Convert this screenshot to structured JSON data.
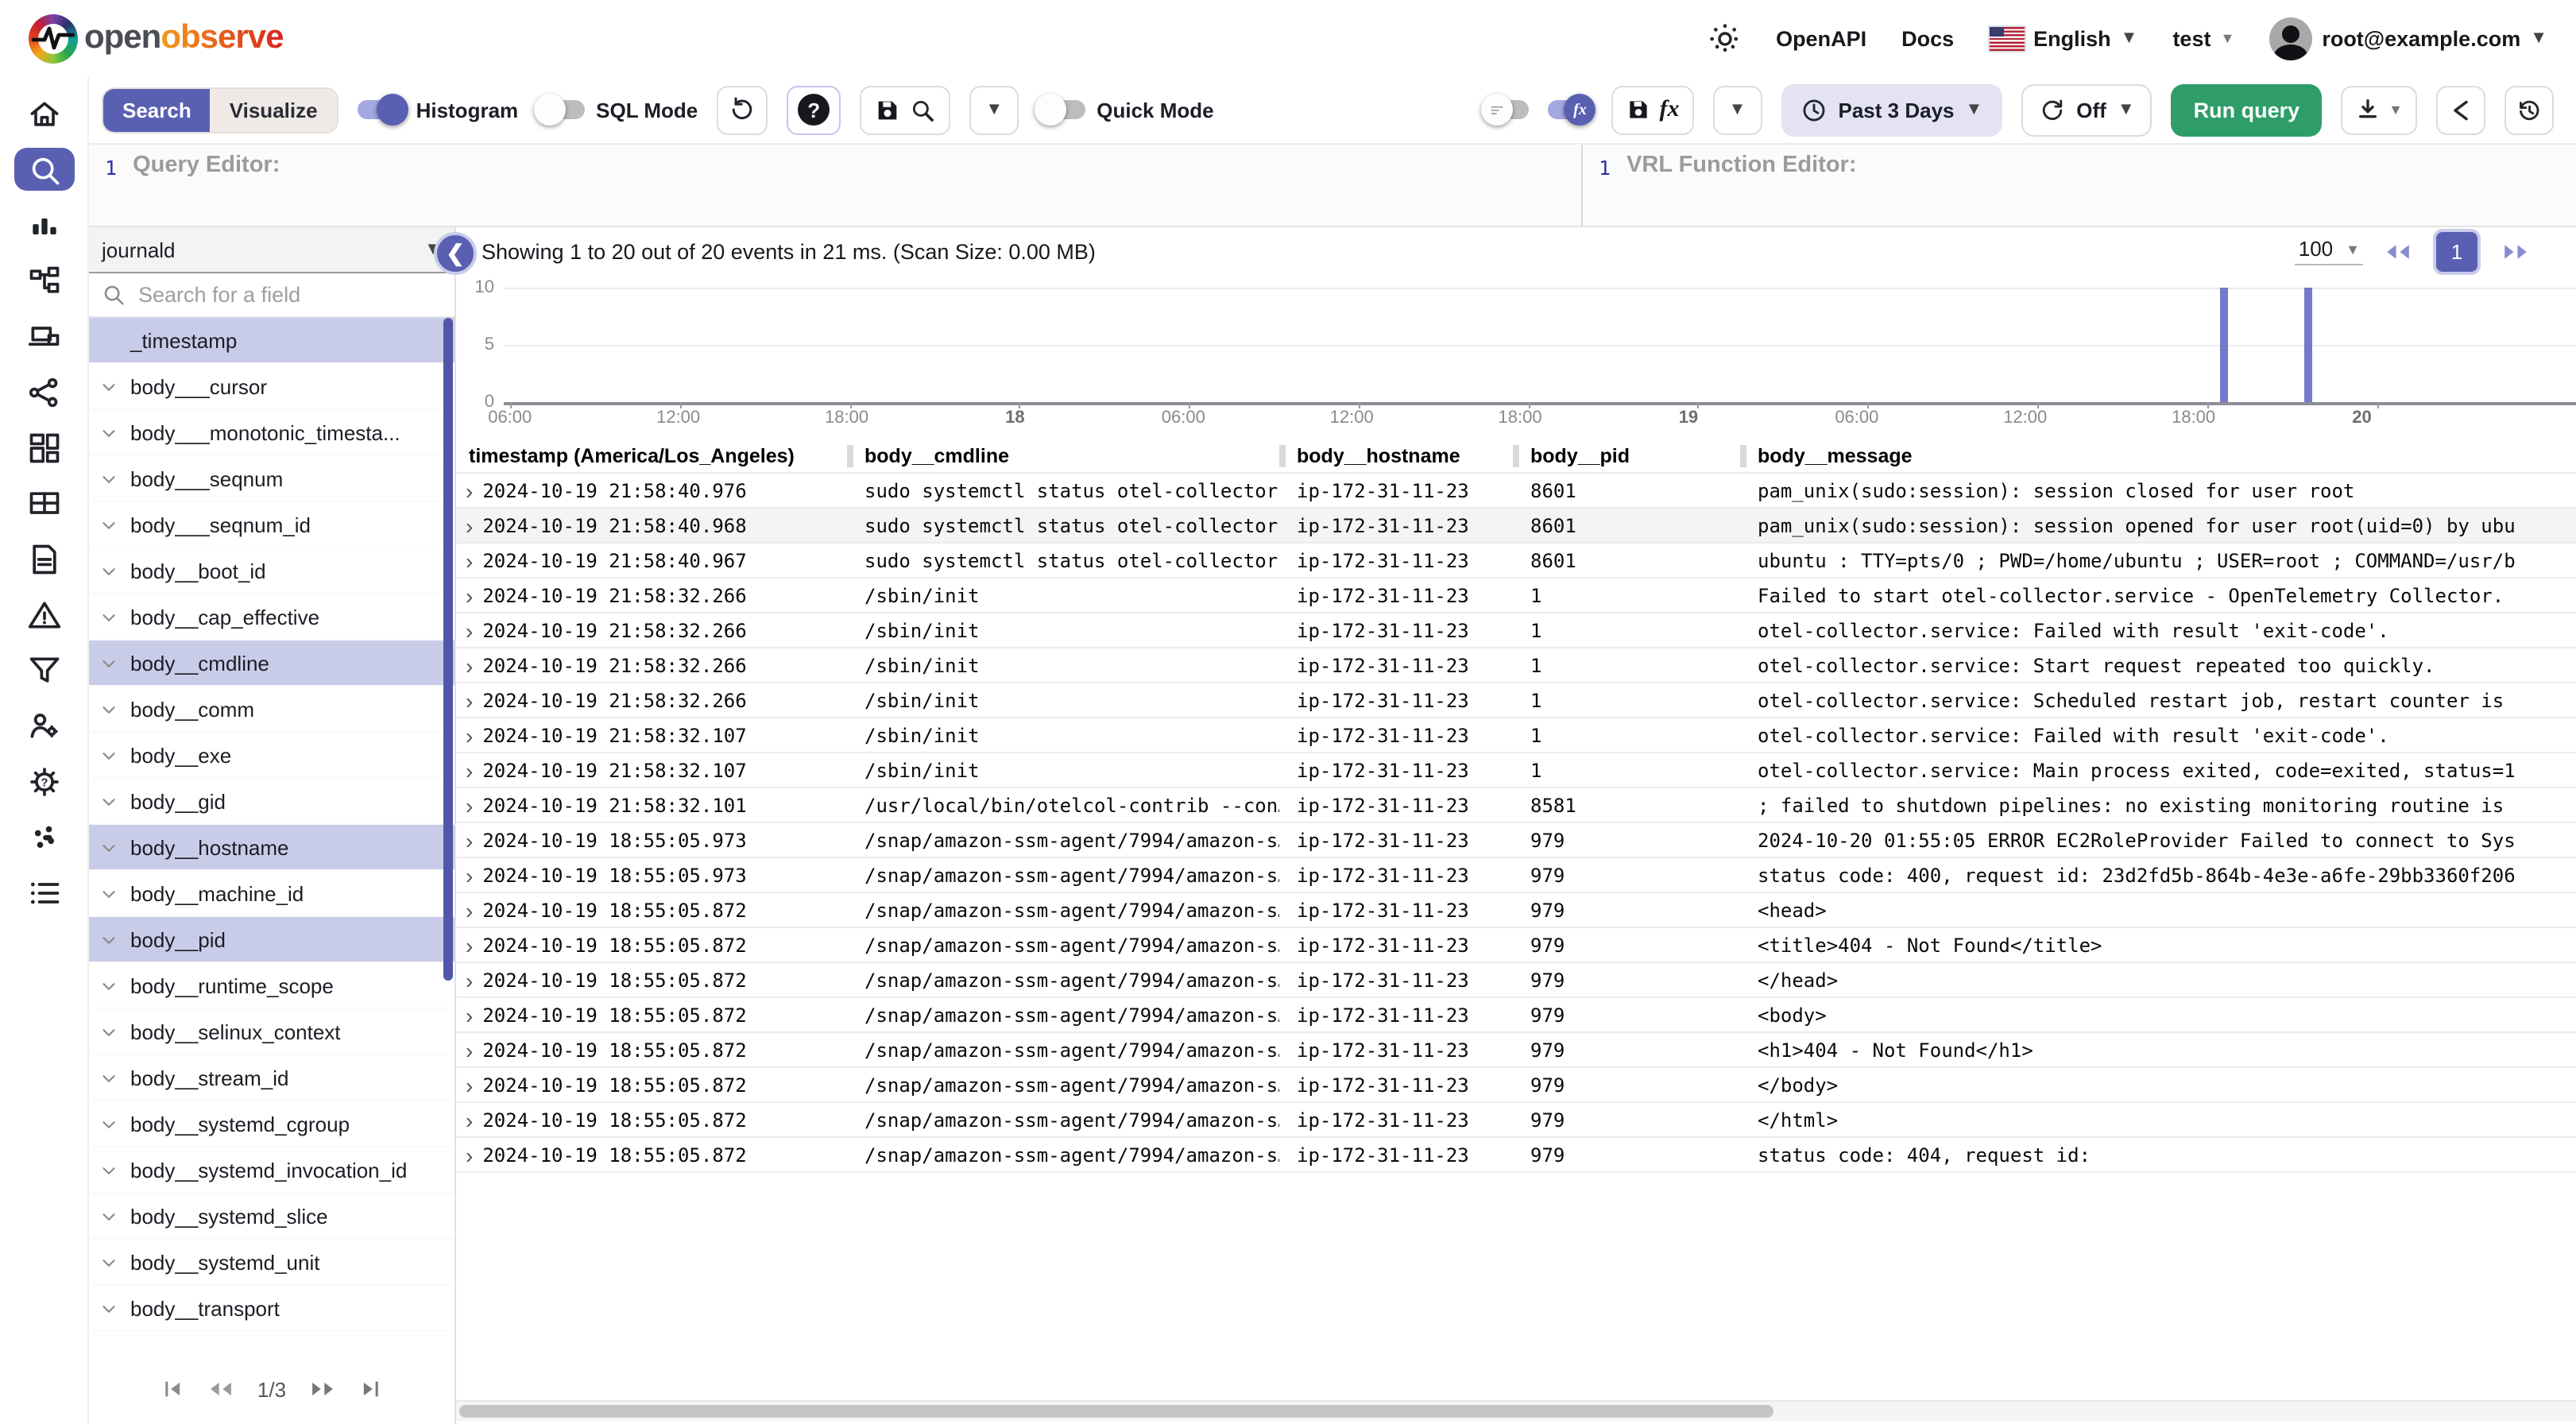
{
  "colors": {
    "primary": "#5960b2",
    "run_query_green": "#2e9d68",
    "bar_purple": "#747ac8",
    "field_selected_bg": "#c9cce9",
    "time_range_bg": "#e3e3f4"
  },
  "header": {
    "logo_open": "open",
    "logo_observe": "observe",
    "openapi": "OpenAPI",
    "docs": "Docs",
    "language": "English",
    "org": "test",
    "email": "root@example.com",
    "icons": [
      "theme-sun-icon",
      "us-flag-icon",
      "avatar"
    ]
  },
  "sidebar": {
    "items": [
      {
        "icon": "home-icon",
        "active": false
      },
      {
        "icon": "search-logs-icon",
        "active": true
      },
      {
        "icon": "metrics-icon",
        "active": false
      },
      {
        "icon": "traces-icon",
        "active": false
      },
      {
        "icon": "rum-monitor-icon",
        "active": false
      },
      {
        "icon": "pipelines-icon",
        "active": false
      },
      {
        "icon": "dashboards-icon",
        "active": false
      },
      {
        "icon": "streams-icon",
        "active": false
      },
      {
        "icon": "reports-icon",
        "active": false
      },
      {
        "icon": "alerts-icon",
        "active": false
      },
      {
        "icon": "filter-icon",
        "active": false
      },
      {
        "icon": "iam-icon",
        "active": false
      },
      {
        "icon": "settings-gear-icon",
        "active": false
      },
      {
        "icon": "slack-icon",
        "active": false
      },
      {
        "icon": "about-list-icon",
        "active": false
      }
    ]
  },
  "toolbar": {
    "search_tab": "Search",
    "visualize_tab": "Visualize",
    "histogram_label": "Histogram",
    "histogram_on": true,
    "sql_mode_label": "SQL Mode",
    "sql_mode_on": false,
    "quick_mode_label": "Quick Mode",
    "quick_mode_on": false,
    "fx_label": "fx",
    "time_range": "Past 3 Days",
    "auto_refresh": "Off",
    "run_query": "Run query"
  },
  "editors": {
    "query_line_number": "1",
    "query_placeholder": "Query Editor:",
    "vrl_line_number": "1",
    "vrl_placeholder": "VRL Function Editor:"
  },
  "fields_panel": {
    "stream": "journald",
    "search_placeholder": "Search for a field",
    "pagination": "1/3",
    "fields": [
      {
        "name": "_timestamp",
        "selected": true,
        "expandable": false
      },
      {
        "name": "body___cursor",
        "selected": false,
        "expandable": true
      },
      {
        "name": "body___monotonic_timesta...",
        "selected": false,
        "expandable": true
      },
      {
        "name": "body___seqnum",
        "selected": false,
        "expandable": true
      },
      {
        "name": "body___seqnum_id",
        "selected": false,
        "expandable": true
      },
      {
        "name": "body__boot_id",
        "selected": false,
        "expandable": true
      },
      {
        "name": "body__cap_effective",
        "selected": false,
        "expandable": true
      },
      {
        "name": "body__cmdline",
        "selected": true,
        "expandable": true
      },
      {
        "name": "body__comm",
        "selected": false,
        "expandable": true
      },
      {
        "name": "body__exe",
        "selected": false,
        "expandable": true
      },
      {
        "name": "body__gid",
        "selected": false,
        "expandable": true
      },
      {
        "name": "body__hostname",
        "selected": true,
        "expandable": true
      },
      {
        "name": "body__machine_id",
        "selected": false,
        "expandable": true
      },
      {
        "name": "body__pid",
        "selected": true,
        "expandable": true
      },
      {
        "name": "body__runtime_scope",
        "selected": false,
        "expandable": true
      },
      {
        "name": "body__selinux_context",
        "selected": false,
        "expandable": true
      },
      {
        "name": "body__stream_id",
        "selected": false,
        "expandable": true
      },
      {
        "name": "body__systemd_cgroup",
        "selected": false,
        "expandable": true
      },
      {
        "name": "body__systemd_invocation_id",
        "selected": false,
        "expandable": true
      },
      {
        "name": "body__systemd_slice",
        "selected": false,
        "expandable": true
      },
      {
        "name": "body__systemd_unit",
        "selected": false,
        "expandable": true
      },
      {
        "name": "body__transport",
        "selected": false,
        "expandable": true
      }
    ]
  },
  "results": {
    "summary": "Showing 1 to 20 out of 20 events in 21 ms. (Scan Size: 0.00 MB)",
    "per_page": "100",
    "page": "1"
  },
  "chart_data": {
    "type": "bar",
    "title": "",
    "xlabel": "",
    "ylabel": "",
    "y_ticks": [
      0,
      5,
      10
    ],
    "ylim": [
      0,
      10
    ],
    "grid": true,
    "x_ticks": [
      {
        "label": "06:00",
        "bold": false
      },
      {
        "label": "12:00",
        "bold": false
      },
      {
        "label": "18:00",
        "bold": false
      },
      {
        "label": "18",
        "bold": true
      },
      {
        "label": "06:00",
        "bold": false
      },
      {
        "label": "12:00",
        "bold": false
      },
      {
        "label": "18:00",
        "bold": false
      },
      {
        "label": "19",
        "bold": true
      },
      {
        "label": "06:00",
        "bold": false
      },
      {
        "label": "12:00",
        "bold": false
      },
      {
        "label": "18:00",
        "bold": false
      },
      {
        "label": "20",
        "bold": true
      }
    ],
    "tick_start_frac": 0.003,
    "tick_step_frac": 0.0819,
    "bars": [
      {
        "approx_time": "2024-10-19 18:55",
        "value": 10,
        "x_frac": 0.828
      },
      {
        "approx_time": "2024-10-19 21:58",
        "value": 10,
        "x_frac": 0.869
      }
    ]
  },
  "table": {
    "columns": [
      "timestamp (America/Los_Angeles)",
      "body__cmdline",
      "body__hostname",
      "body__pid",
      "body__message"
    ],
    "highlight_row": 1,
    "rows": [
      {
        "ts": "2024-10-19 21:58:40.976",
        "cmdline": "sudo systemctl status otel-collector",
        "hostname": "ip-172-31-11-23",
        "pid": "8601",
        "message": "pam_unix(sudo:session): session closed for user root"
      },
      {
        "ts": "2024-10-19 21:58:40.968",
        "cmdline": "sudo systemctl status otel-collector",
        "hostname": "ip-172-31-11-23",
        "pid": "8601",
        "message": "pam_unix(sudo:session): session opened for user root(uid=0) by ubu"
      },
      {
        "ts": "2024-10-19 21:58:40.967",
        "cmdline": "sudo systemctl status otel-collector",
        "hostname": "ip-172-31-11-23",
        "pid": "8601",
        "message": "ubuntu : TTY=pts/0 ; PWD=/home/ubuntu ; USER=root ; COMMAND=/usr/b"
      },
      {
        "ts": "2024-10-19 21:58:32.266",
        "cmdline": "/sbin/init",
        "hostname": "ip-172-31-11-23",
        "pid": "1",
        "message": "Failed to start otel-collector.service - OpenTelemetry Collector."
      },
      {
        "ts": "2024-10-19 21:58:32.266",
        "cmdline": "/sbin/init",
        "hostname": "ip-172-31-11-23",
        "pid": "1",
        "message": "otel-collector.service: Failed with result 'exit-code'."
      },
      {
        "ts": "2024-10-19 21:58:32.266",
        "cmdline": "/sbin/init",
        "hostname": "ip-172-31-11-23",
        "pid": "1",
        "message": "otel-collector.service: Start request repeated too quickly."
      },
      {
        "ts": "2024-10-19 21:58:32.266",
        "cmdline": "/sbin/init",
        "hostname": "ip-172-31-11-23",
        "pid": "1",
        "message": "otel-collector.service: Scheduled restart job, restart counter is"
      },
      {
        "ts": "2024-10-19 21:58:32.107",
        "cmdline": "/sbin/init",
        "hostname": "ip-172-31-11-23",
        "pid": "1",
        "message": "otel-collector.service: Failed with result 'exit-code'."
      },
      {
        "ts": "2024-10-19 21:58:32.107",
        "cmdline": "/sbin/init",
        "hostname": "ip-172-31-11-23",
        "pid": "1",
        "message": "otel-collector.service: Main process exited, code=exited, status=1"
      },
      {
        "ts": "2024-10-19 21:58:32.101",
        "cmdline": "/usr/local/bin/otelcol-contrib --con…",
        "hostname": "ip-172-31-11-23",
        "pid": "8581",
        "message": "; failed to shutdown pipelines: no existing monitoring routine is"
      },
      {
        "ts": "2024-10-19 18:55:05.973",
        "cmdline": "/snap/amazon-ssm-agent/7994/amazon-s…",
        "hostname": "ip-172-31-11-23",
        "pid": "979",
        "message": "2024-10-20 01:55:05 ERROR EC2RoleProvider Failed to connect to Sys"
      },
      {
        "ts": "2024-10-19 18:55:05.973",
        "cmdline": "/snap/amazon-ssm-agent/7994/amazon-s…",
        "hostname": "ip-172-31-11-23",
        "pid": "979",
        "message": "status code: 400, request id: 23d2fd5b-864b-4e3e-a6fe-29bb3360f206"
      },
      {
        "ts": "2024-10-19 18:55:05.872",
        "cmdline": "/snap/amazon-ssm-agent/7994/amazon-s…",
        "hostname": "ip-172-31-11-23",
        "pid": "979",
        "message": "<head>"
      },
      {
        "ts": "2024-10-19 18:55:05.872",
        "cmdline": "/snap/amazon-ssm-agent/7994/amazon-s…",
        "hostname": "ip-172-31-11-23",
        "pid": "979",
        "message": "<title>404 - Not Found</title>"
      },
      {
        "ts": "2024-10-19 18:55:05.872",
        "cmdline": "/snap/amazon-ssm-agent/7994/amazon-s…",
        "hostname": "ip-172-31-11-23",
        "pid": "979",
        "message": "</head>"
      },
      {
        "ts": "2024-10-19 18:55:05.872",
        "cmdline": "/snap/amazon-ssm-agent/7994/amazon-s…",
        "hostname": "ip-172-31-11-23",
        "pid": "979",
        "message": "<body>"
      },
      {
        "ts": "2024-10-19 18:55:05.872",
        "cmdline": "/snap/amazon-ssm-agent/7994/amazon-s…",
        "hostname": "ip-172-31-11-23",
        "pid": "979",
        "message": "<h1>404 - Not Found</h1>"
      },
      {
        "ts": "2024-10-19 18:55:05.872",
        "cmdline": "/snap/amazon-ssm-agent/7994/amazon-s…",
        "hostname": "ip-172-31-11-23",
        "pid": "979",
        "message": "</body>"
      },
      {
        "ts": "2024-10-19 18:55:05.872",
        "cmdline": "/snap/amazon-ssm-agent/7994/amazon-s…",
        "hostname": "ip-172-31-11-23",
        "pid": "979",
        "message": "</html>"
      },
      {
        "ts": "2024-10-19 18:55:05.872",
        "cmdline": "/snap/amazon-ssm-agent/7994/amazon-s…",
        "hostname": "ip-172-31-11-23",
        "pid": "979",
        "message": "status code: 404, request id:"
      }
    ]
  }
}
